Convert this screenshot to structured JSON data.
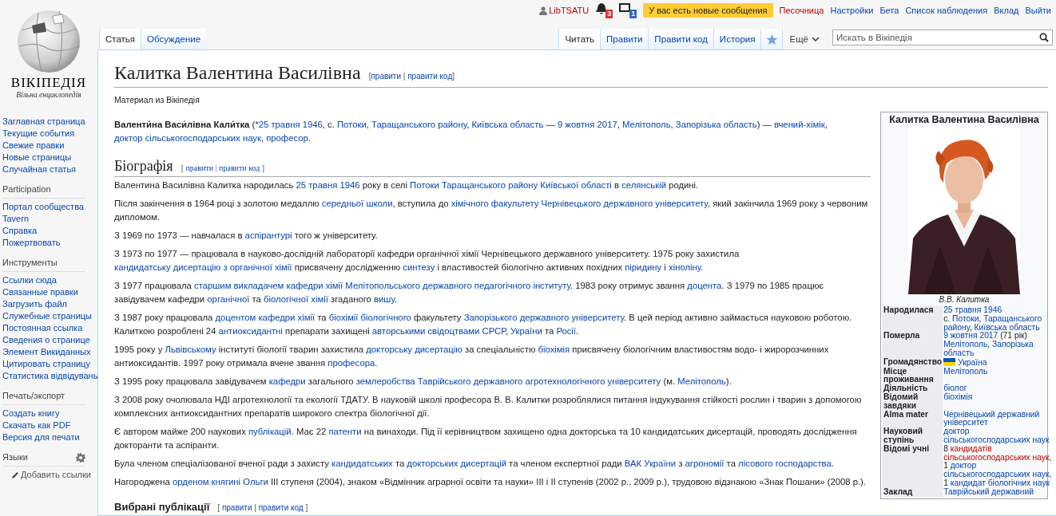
{
  "personal": {
    "user": "LibTSATU",
    "notifications": [
      {
        "kind": "alert",
        "count": "3"
      },
      {
        "kind": "notice",
        "count": "1"
      }
    ],
    "messages": "У вас есть новые сообщения",
    "links": [
      {
        "label": "Песочница",
        "redlink": true
      },
      {
        "label": "Настройки",
        "redlink": false
      },
      {
        "label": "Бета",
        "redlink": false
      },
      {
        "label": "Список наблюдения",
        "redlink": false
      },
      {
        "label": "Вклад",
        "redlink": false
      },
      {
        "label": "Выйти",
        "redlink": false
      }
    ]
  },
  "logo": {
    "wordmark": "ВІКІПЕДІЯ",
    "tagline": "Вільна енциклопедія"
  },
  "namespace_tabs": [
    {
      "label": "Статья",
      "selected": true
    },
    {
      "label": "Обсуждение",
      "selected": false
    }
  ],
  "view_tabs": [
    {
      "label": "Читать",
      "selected": true
    },
    {
      "label": "Правити",
      "selected": false
    },
    {
      "label": "Правити код",
      "selected": false
    },
    {
      "label": "История",
      "selected": false
    }
  ],
  "more_menu": "Ещё",
  "search": {
    "placeholder": "Искать в Вікіпедія"
  },
  "sidebar": {
    "main": [
      "Заглавная страница",
      "Текущие события",
      "Свежие правки",
      "Новые страницы",
      "Случайная статья"
    ],
    "sections": [
      {
        "heading": "Participation",
        "items": [
          "Портал сообщества",
          "Tavern",
          "Справка",
          "Пожертвовать"
        ]
      },
      {
        "heading": "Инструменты",
        "items": [
          "Ссылки сюда",
          "Связанные правки",
          "Загрузить файл",
          "Служебные страницы",
          "Постоянная ссылка",
          "Сведения о странице",
          "Элемент Викиданных",
          "Цитировать страницу",
          "Статистика відвідувань"
        ]
      },
      {
        "heading": "Печать/экспорт",
        "items": [
          "Создать книгу",
          "Скачать как PDF",
          "Версия для печати"
        ]
      }
    ],
    "languages": {
      "heading": "Языки",
      "add_link": "Добавить ссылки"
    }
  },
  "article": {
    "title": "Калитка Валентина Василівна",
    "title_edit": [
      {
        "kind": "text",
        "t": "["
      },
      {
        "kind": "link",
        "t": "правити"
      },
      {
        "kind": "text",
        "t": " | "
      },
      {
        "kind": "link",
        "t": "правити код"
      },
      {
        "kind": "text",
        "t": "]"
      }
    ],
    "tagline": "Материал из Вікіпедія",
    "lead": [
      {
        "kind": "bold",
        "t": "Валенти́на Васи́лівна Кали́тка"
      },
      {
        "kind": "text",
        "t": " ("
      },
      {
        "kind": "link",
        "t": "*25 травня 1946"
      },
      {
        "kind": "text",
        "t": ", с. "
      },
      {
        "kind": "link",
        "t": "Потоки"
      },
      {
        "kind": "text",
        "t": ", "
      },
      {
        "kind": "link",
        "t": "Таращанського району"
      },
      {
        "kind": "text",
        "t": ", "
      },
      {
        "kind": "link",
        "t": "Київська область"
      },
      {
        "kind": "text",
        "t": " — "
      },
      {
        "kind": "link",
        "t": "9 жовтня 2017"
      },
      {
        "kind": "text",
        "t": ", "
      },
      {
        "kind": "link",
        "t": "Мелітополь"
      },
      {
        "kind": "text",
        "t": ", "
      },
      {
        "kind": "link",
        "t": "Запорізька область"
      },
      {
        "kind": "text",
        "t": ") — "
      },
      {
        "kind": "link",
        "t": "вчений-хімік"
      },
      {
        "kind": "text",
        "t": ", "
      },
      {
        "kind": "link",
        "t": "доктор сільськогосподарських наук"
      },
      {
        "kind": "text",
        "t": ", "
      },
      {
        "kind": "link",
        "t": "професор"
      },
      {
        "kind": "text",
        "t": "."
      }
    ],
    "infobox": {
      "title": "Калитка Валентина Василівна",
      "caption": "В.В. Калитка",
      "rows": [
        {
          "kind": "plain",
          "label": "Народилася",
          "lines": [
            [
              {
                "kind": "link",
                "t": "25 травня 1946"
              }
            ],
            [
              {
                "kind": "text",
                "t": "с. "
              },
              {
                "kind": "link",
                "t": "Потоки"
              },
              {
                "kind": "text",
                "t": ", "
              },
              {
                "kind": "link",
                "t": "Таращанського"
              }
            ],
            [
              {
                "kind": "link",
                "t": "району"
              },
              {
                "kind": "text",
                "t": ", "
              },
              {
                "kind": "link",
                "t": "Київська область"
              }
            ]
          ]
        },
        {
          "kind": "plain",
          "label": "Померла",
          "lines": [
            [
              {
                "kind": "link",
                "t": "9 жовтня 2017"
              },
              {
                "kind": "text",
                "t": " (71 рік)"
              }
            ],
            [
              {
                "kind": "link",
                "t": "Мелітополь"
              },
              {
                "kind": "text",
                "t": ", "
              },
              {
                "kind": "link",
                "t": "Запорізька"
              }
            ],
            [
              {
                "kind": "link",
                "t": "область"
              }
            ]
          ]
        },
        {
          "kind": "flag",
          "label": "Громадянство",
          "lines": [
            [
              {
                "kind": "link",
                "t": "Україна"
              }
            ]
          ]
        },
        {
          "kind": "plain",
          "label": "Місце проживання",
          "lines": [
            [
              {
                "kind": "link",
                "t": "Мелітополь"
              }
            ]
          ]
        },
        {
          "kind": "plain",
          "label": "Діяльність",
          "lines": [
            [
              {
                "kind": "link",
                "t": "біолог"
              }
            ]
          ]
        },
        {
          "kind": "plain",
          "label": "Відомий завдяки",
          "lines": [
            [
              {
                "kind": "link",
                "t": "біохімія"
              }
            ]
          ]
        },
        {
          "kind": "plain",
          "label": "Alma mater",
          "lines": [
            [
              {
                "kind": "link",
                "t": "Чернівецький державний"
              }
            ],
            [
              {
                "kind": "link",
                "t": "університет"
              }
            ]
          ]
        },
        {
          "kind": "plain",
          "label": "Науковий ступінь",
          "lines": [
            [
              {
                "kind": "link",
                "t": "доктор"
              }
            ],
            [
              {
                "kind": "link",
                "t": "сільськогосподарських наук"
              }
            ]
          ]
        },
        {
          "kind": "plain",
          "label": "Відомі учні",
          "lines": [
            [
              {
                "kind": "text",
                "t": "8 "
              },
              {
                "kind": "redlink",
                "t": "кандидатів"
              }
            ],
            [
              {
                "kind": "redlink",
                "t": "сільськогосподарських наук"
              },
              {
                "kind": "text",
                "t": ","
              }
            ],
            [
              {
                "kind": "text",
                "t": "1 "
              },
              {
                "kind": "link",
                "t": "доктор"
              }
            ],
            [
              {
                "kind": "link",
                "t": "сільськогосподарських наук"
              },
              {
                "kind": "text",
                "t": ","
              }
            ],
            [
              {
                "kind": "text",
                "t": "1 "
              },
              {
                "kind": "link",
                "t": "кандидат біологічних наук"
              }
            ]
          ]
        },
        {
          "kind": "plain",
          "label": "Заклад",
          "lines": [
            [
              {
                "kind": "link",
                "t": "Таврійський державний"
              }
            ]
          ]
        }
      ]
    },
    "sections": [
      {
        "kind": "h2",
        "heading": "Біографія",
        "edit": [
          {
            "kind": "text",
            "t": "[ "
          },
          {
            "kind": "link",
            "t": "правити"
          },
          {
            "kind": "text",
            "t": " | "
          },
          {
            "kind": "link",
            "t": "правити код"
          },
          {
            "kind": "text",
            "t": " ]"
          }
        ],
        "paragraphs": [
          [
            {
              "kind": "text",
              "t": "Валентина Василівна Калитка народилась "
            },
            {
              "kind": "link",
              "t": "25 травня 1946"
            },
            {
              "kind": "text",
              "t": " року в селі "
            },
            {
              "kind": "link",
              "t": "Потоки Таращанського району Київської області"
            },
            {
              "kind": "text",
              "t": " в "
            },
            {
              "kind": "link",
              "t": "селянській"
            },
            {
              "kind": "text",
              "t": " родині."
            }
          ],
          [
            {
              "kind": "text",
              "t": "Після закінчення в 1964 році з золотою медаллю "
            },
            {
              "kind": "link",
              "t": "середньої школи"
            },
            {
              "kind": "text",
              "t": ", вступила до "
            },
            {
              "kind": "link",
              "t": "хімічного факультету Чернівецького державного університету"
            },
            {
              "kind": "text",
              "t": ", який закінчила 1969 року з червоним дипломом."
            }
          ],
          [
            {
              "kind": "text",
              "t": "З 1969 по 1973 — навчалася в "
            },
            {
              "kind": "link",
              "t": "аспірантурі"
            },
            {
              "kind": "text",
              "t": " того ж університету."
            }
          ],
          [
            {
              "kind": "text",
              "t": "З 1973 по 1977 — працювала в науково-дослідній лабораторії кафедри органічної хімії Чернівецького державного університету. 1975 року захистила "
            },
            {
              "kind": "link",
              "t": "кандидатську дисертацію з органічної хімії"
            },
            {
              "kind": "text",
              "t": " присвячену дослідженню "
            },
            {
              "kind": "link",
              "t": "синтезу"
            },
            {
              "kind": "text",
              "t": " і властивостей біологічно активних похідних "
            },
            {
              "kind": "link",
              "t": "піридину"
            },
            {
              "kind": "text",
              "t": " і "
            },
            {
              "kind": "link",
              "t": "хіноліну"
            },
            {
              "kind": "text",
              "t": "."
            }
          ],
          [
            {
              "kind": "text",
              "t": "З 1977 працювала "
            },
            {
              "kind": "link",
              "t": "старшим викладачем кафедри хімії Мелітопольського державного педагогічного інституту"
            },
            {
              "kind": "text",
              "t": ". 1983 року отримує звання "
            },
            {
              "kind": "link",
              "t": "доцента"
            },
            {
              "kind": "text",
              "t": ". З 1979 по 1985 працює завідувачем кафедри "
            },
            {
              "kind": "link",
              "t": "органічної"
            },
            {
              "kind": "text",
              "t": " та "
            },
            {
              "kind": "link",
              "t": "біологічної хімії"
            },
            {
              "kind": "text",
              "t": " згаданого "
            },
            {
              "kind": "link",
              "t": "вишу"
            },
            {
              "kind": "text",
              "t": "."
            }
          ],
          [
            {
              "kind": "text",
              "t": "З 1987 року працювала "
            },
            {
              "kind": "link",
              "t": "доцентом кафедри хімії"
            },
            {
              "kind": "text",
              "t": " та "
            },
            {
              "kind": "link",
              "t": "біохімії біологічного"
            },
            {
              "kind": "text",
              "t": " факультету "
            },
            {
              "kind": "link",
              "t": "Запорізького державного університету"
            },
            {
              "kind": "text",
              "t": ". В цей період активно займається науковою роботою. Калиткою розроблені 24 "
            },
            {
              "kind": "link",
              "t": "антиоксидантні"
            },
            {
              "kind": "text",
              "t": " препарати захищені "
            },
            {
              "kind": "link",
              "t": "авторськими свідоцтвами СРСР"
            },
            {
              "kind": "text",
              "t": ", "
            },
            {
              "kind": "link",
              "t": "України"
            },
            {
              "kind": "text",
              "t": " та "
            },
            {
              "kind": "link",
              "t": "Росії"
            },
            {
              "kind": "text",
              "t": "."
            }
          ],
          [
            {
              "kind": "text",
              "t": "1995 року у "
            },
            {
              "kind": "link",
              "t": "Львівському"
            },
            {
              "kind": "text",
              "t": " інституті біології тварин захистила "
            },
            {
              "kind": "link",
              "t": "докторську дисертацію"
            },
            {
              "kind": "text",
              "t": " за спеціальністю "
            },
            {
              "kind": "link",
              "t": "біохімія"
            },
            {
              "kind": "text",
              "t": " присвячену біологічним властивостям водо- і жиророзчинних антиоксидантів. 1997 року отримала вчене звання "
            },
            {
              "kind": "link",
              "t": "професора"
            },
            {
              "kind": "text",
              "t": "."
            }
          ],
          [
            {
              "kind": "text",
              "t": "З 1995 року працювала завідувачем "
            },
            {
              "kind": "link",
              "t": "кафедри"
            },
            {
              "kind": "text",
              "t": " загального "
            },
            {
              "kind": "link",
              "t": "землеробства Таврійського державного агротехнологічного університету"
            },
            {
              "kind": "text",
              "t": " (м. "
            },
            {
              "kind": "link",
              "t": "Мелітополь"
            },
            {
              "kind": "text",
              "t": ")."
            }
          ],
          [
            {
              "kind": "text",
              "t": "З 2008 року очолювала НДІ агротехнології та екології ТДАТУ. В науковій школі професора В. В. Калитки розроблялися питання індукування стійкості рослин і тварин з допомогою комплексних антиоксидантних препаратів широкого спектра біологічної дії."
            }
          ],
          [
            {
              "kind": "text",
              "t": "Є автором майже 200 наукових "
            },
            {
              "kind": "link",
              "t": "публікацій"
            },
            {
              "kind": "text",
              "t": ". Має 22 "
            },
            {
              "kind": "link",
              "t": "патенти"
            },
            {
              "kind": "text",
              "t": " на винаходи. Під її керівництвом захищено одна докторська та 10 кандидатських дисертацій, проводять дослідження докторанти та аспіранти."
            }
          ],
          [
            {
              "kind": "text",
              "t": "Була членом спеціалізованої вченої ради з захисту "
            },
            {
              "kind": "link",
              "t": "кандидатських"
            },
            {
              "kind": "text",
              "t": " та "
            },
            {
              "kind": "link",
              "t": "докторських дисертацій"
            },
            {
              "kind": "text",
              "t": " та членом експертної ради "
            },
            {
              "kind": "link",
              "t": "ВАК України"
            },
            {
              "kind": "text",
              "t": " з "
            },
            {
              "kind": "link",
              "t": "агрономії"
            },
            {
              "kind": "text",
              "t": " та "
            },
            {
              "kind": "link",
              "t": "лісового господарства"
            },
            {
              "kind": "text",
              "t": "."
            }
          ],
          [
            {
              "kind": "text",
              "t": "Нагороджена "
            },
            {
              "kind": "link",
              "t": "орденом княгині Ольги"
            },
            {
              "kind": "text",
              "t": " III ступеня (2004), знаком «Відмінник аграрної освіти та науки» III і II ступенів (2002 р., 2009 р.), трудовою відзнакою «Знак Пошани» (2008 р.)."
            }
          ]
        ]
      },
      {
        "kind": "h3",
        "heading": "Вибрані публікації",
        "edit": [
          {
            "kind": "text",
            "t": "[ "
          },
          {
            "kind": "link",
            "t": "правити"
          },
          {
            "kind": "text",
            "t": " | "
          },
          {
            "kind": "link",
            "t": "правити код"
          },
          {
            "kind": "text",
            "t": " ]"
          }
        ]
      }
    ]
  }
}
